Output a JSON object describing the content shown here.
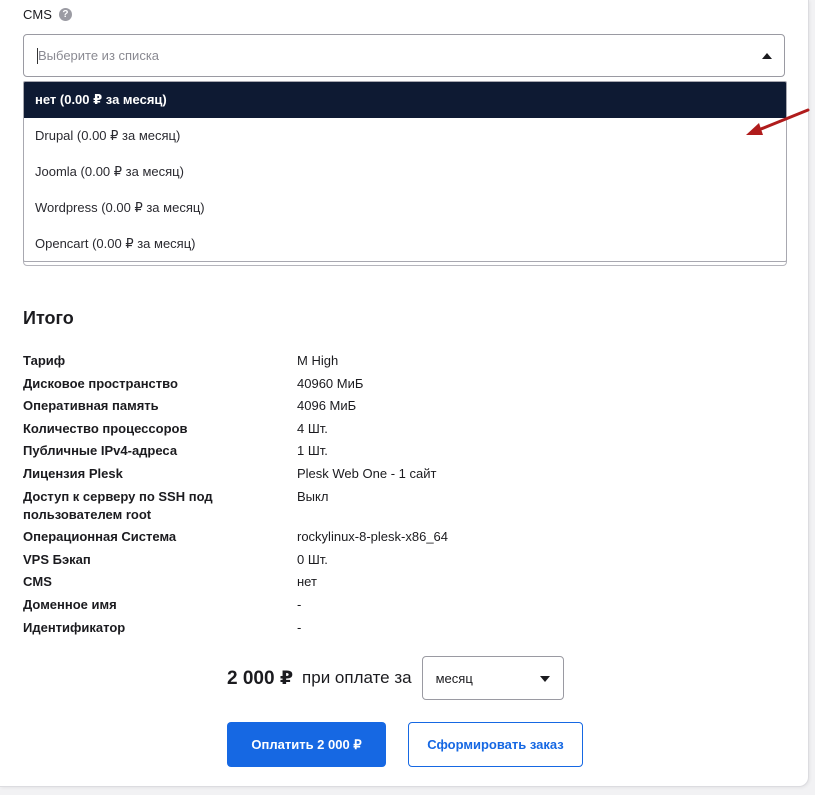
{
  "cms": {
    "label": "CMS",
    "help_glyph": "?",
    "placeholder": "Выберите из списка",
    "options": [
      "нет (0.00 ₽ за месяц)",
      "Drupal (0.00 ₽ за месяц)",
      "Joomla (0.00 ₽ за месяц)",
      "Wordpress (0.00 ₽ за месяц)",
      "Opencart (0.00 ₽ за месяц)"
    ],
    "selected_index": 0
  },
  "summary": {
    "title": "Итого",
    "rows": [
      {
        "key": "Тариф",
        "value": "M High"
      },
      {
        "key": "Дисковое пространство",
        "value": "40960 МиБ"
      },
      {
        "key": "Оперативная память",
        "value": "4096 МиБ"
      },
      {
        "key": "Количество процессоров",
        "value": "4 Шт."
      },
      {
        "key": "Публичные IPv4-адреса",
        "value": "1 Шт."
      },
      {
        "key": "Лицензия Plesk",
        "value": "Plesk Web One - 1 сайт"
      },
      {
        "key": "Доступ к серверу по SSH под пользователем root",
        "value": "Выкл"
      },
      {
        "key": "Операционная Система",
        "value": "rockylinux-8-plesk-x86_64"
      },
      {
        "key": "VPS Бэкап",
        "value": "0 Шт."
      },
      {
        "key": "CMS",
        "value": "нет"
      },
      {
        "key": "Доменное имя",
        "value": "-"
      },
      {
        "key": "Идентификатор",
        "value": "-"
      }
    ]
  },
  "price": {
    "amount": "2 000 ₽",
    "period_text": "при оплате за",
    "period_value": "месяц"
  },
  "buttons": {
    "pay": "Оплатить  2 000 ₽",
    "order": "Сформировать заказ"
  },
  "colors": {
    "accent": "#1668e3",
    "selected_option_bg": "#0e1a33",
    "annotation_arrow": "#b01c1c"
  },
  "icons": {
    "help": "question-circle-icon",
    "dropdown": "caret-up-icon",
    "period_dropdown": "caret-down-icon",
    "annotation": "red-arrow-icon"
  }
}
